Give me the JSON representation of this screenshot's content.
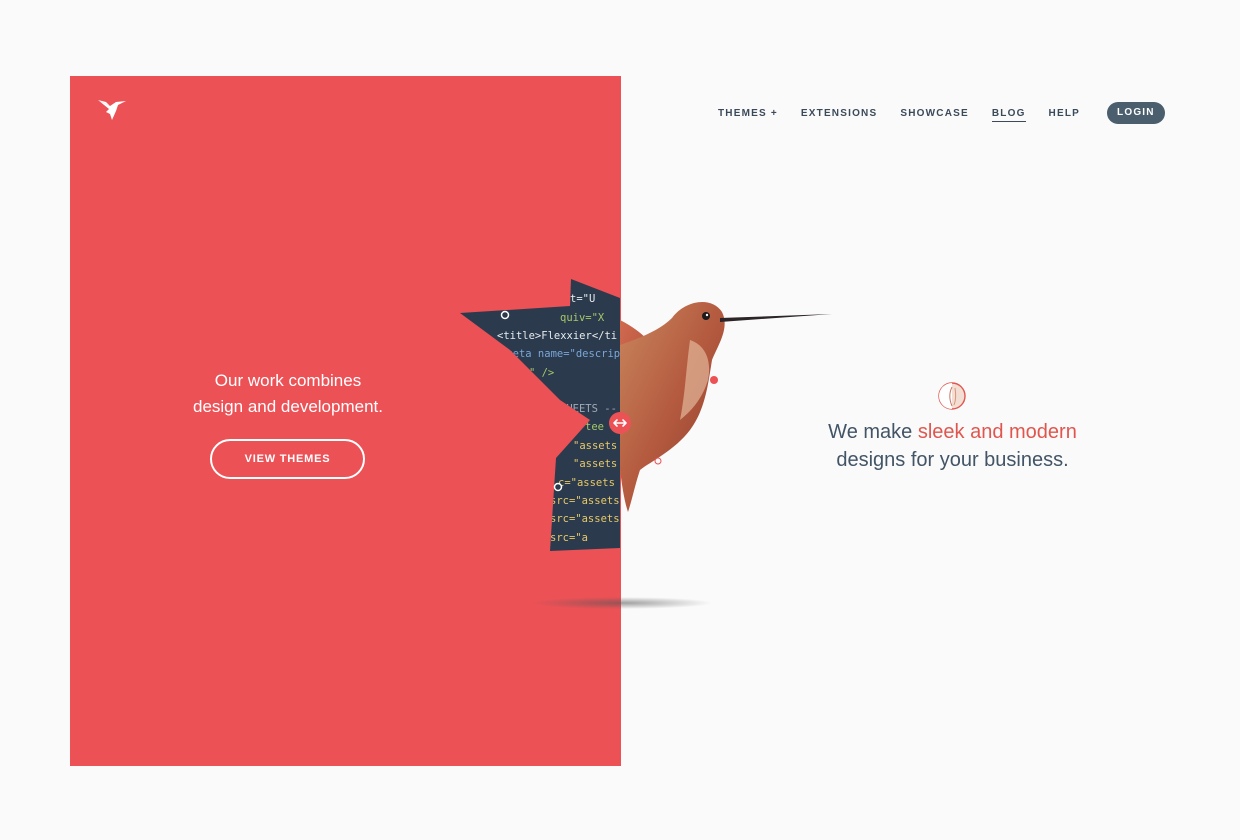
{
  "brand": {
    "logo_icon": "hummingbird-icon"
  },
  "hero_left": {
    "line1": "Our work combines",
    "line2": "design and development.",
    "cta_label": "VIEW THEMES"
  },
  "nav": {
    "items": [
      {
        "label": "THEMES +"
      },
      {
        "label": "EXTENSIONS"
      },
      {
        "label": "SHOWCASE"
      },
      {
        "label": "BLOG"
      },
      {
        "label": "HELP"
      }
    ],
    "active": "BLOG",
    "login_label": "LOGIN"
  },
  "hero_right": {
    "prefix": "We make ",
    "accent": "sleek and modern",
    "line2": "designs for your business."
  },
  "code_snippets": [
    "t=\"U",
    "quiv=\"X",
    "<title>Flexxier</ti",
    "<meta name=\"descrip",
    "ts.\" />",
    "SHEETS --",
    "tee",
    "\"assets",
    "\"assets",
    "c=\"assets",
    "src=\"assets",
    "src=\"assets",
    "src=\"a"
  ],
  "colors": {
    "brand_red": "#ec5156",
    "navy_code": "#2b3b4d",
    "text_dark": "#425466",
    "accent": "#e0564f",
    "login_bg": "#4a5e6d"
  }
}
